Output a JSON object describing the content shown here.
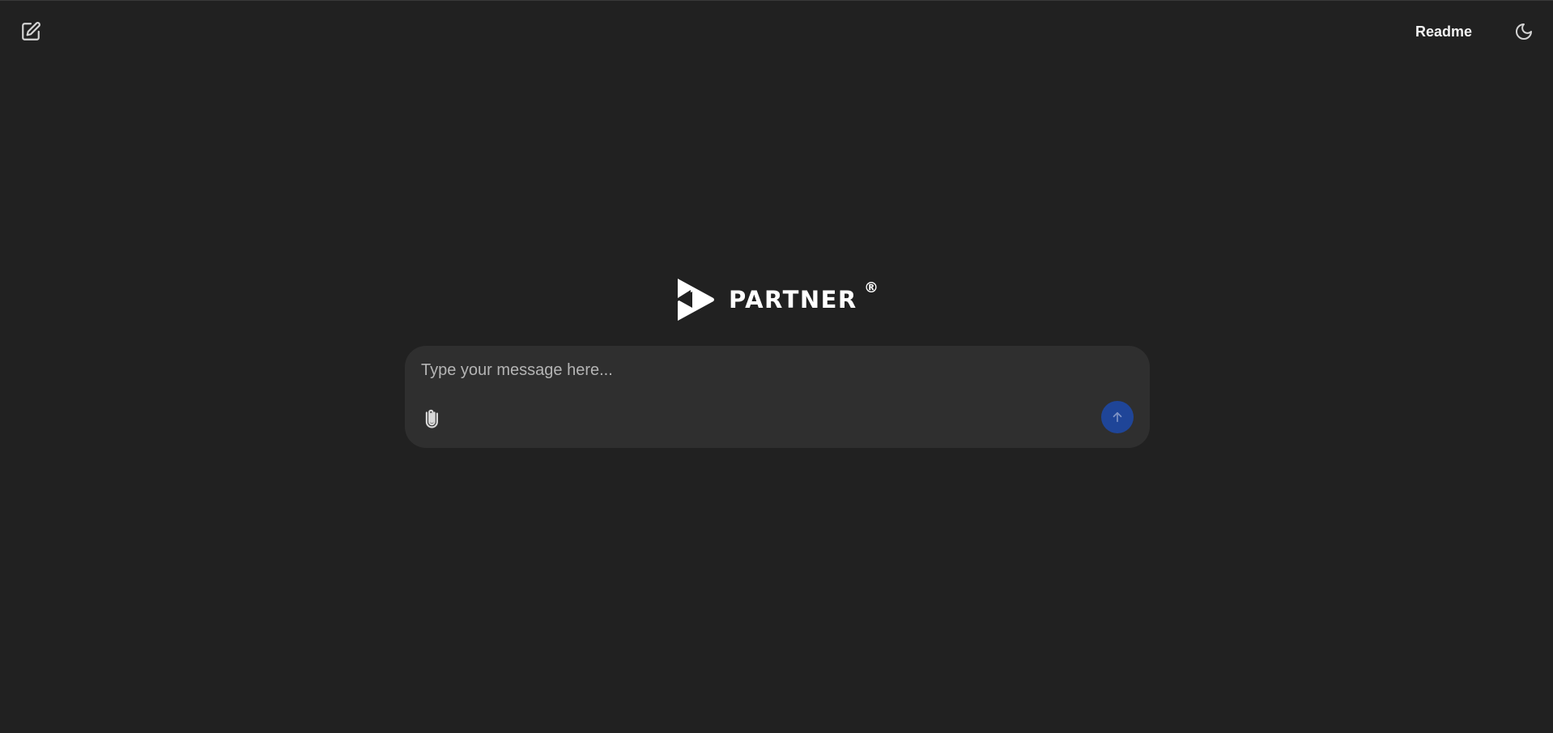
{
  "header": {
    "new_chat_icon": "square-pen-icon",
    "readme_label": "Readme",
    "theme_icon": "moon-icon"
  },
  "logo": {
    "icon": "play-triangle-logo",
    "text": "PARTNER",
    "registered_mark": "®"
  },
  "composer": {
    "placeholder": "Type your message here...",
    "value": "",
    "attach_icon": "paperclip-icon",
    "send_icon": "arrow-up-icon"
  },
  "colors": {
    "background": "#212121",
    "composer_background": "#2f2f2f",
    "send_button": "#1f4598",
    "text": "#ffffff",
    "placeholder": "#b4b4b4"
  }
}
